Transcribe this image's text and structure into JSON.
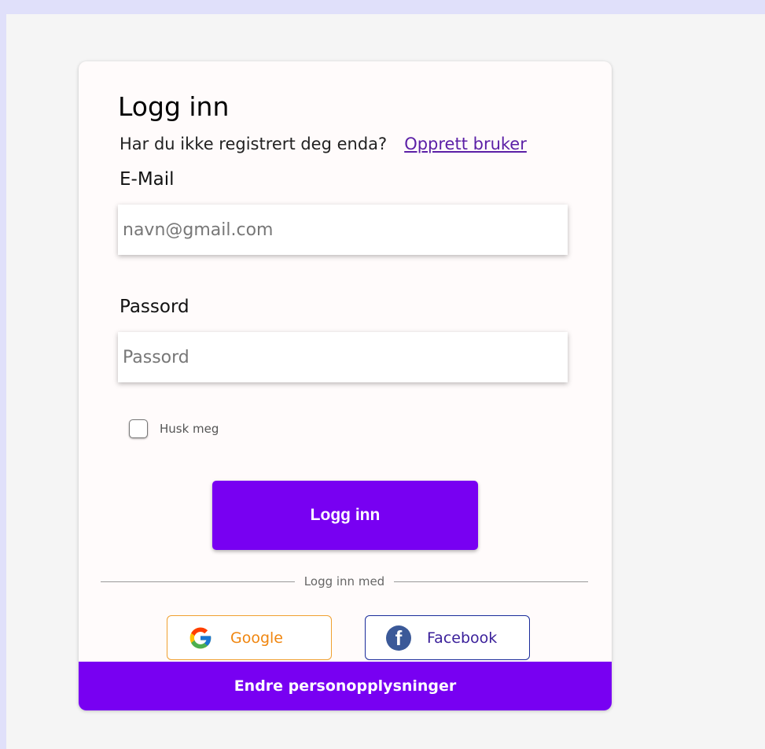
{
  "login": {
    "title": "Logg inn",
    "subtitle": "Har du ikke registrert deg enda?",
    "register_link": "Opprett bruker",
    "email_label": "E-Mail",
    "email_placeholder": "navn@gmail.com",
    "password_label": "Passord",
    "password_placeholder": "Passord",
    "remember_label": "Husk meg",
    "submit_label": "Logg inn",
    "divider_text": "Logg inn med"
  },
  "social": {
    "google_label": "Google",
    "google_icon": "google-icon",
    "facebook_label": "Facebook",
    "facebook_icon": "facebook-icon"
  },
  "footer": {
    "label": "Endre personopplysninger"
  },
  "colors": {
    "accent": "#7800f2",
    "link": "#5b1fa6",
    "google_border": "#f0a030",
    "facebook_border": "#1a2b9a"
  }
}
